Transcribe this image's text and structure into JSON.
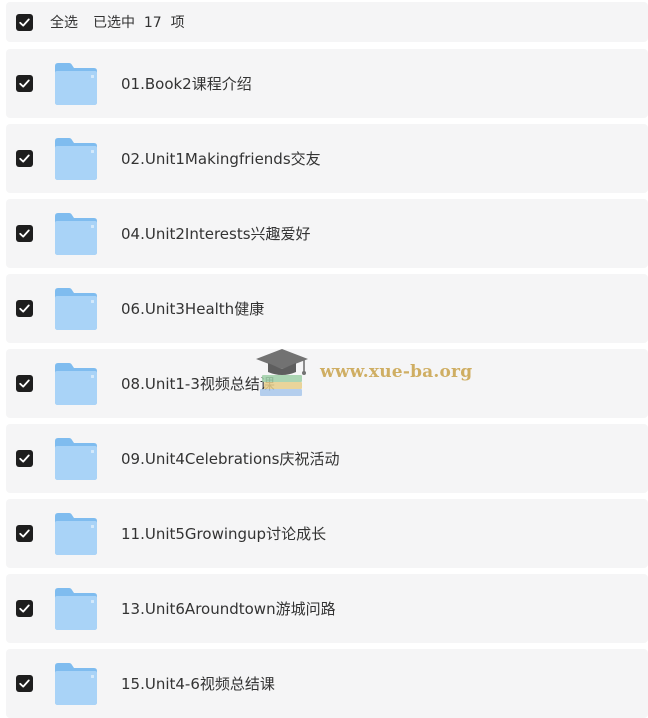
{
  "header": {
    "select_all_label": "全选",
    "selected_text": "已选中  17  项"
  },
  "items": [
    {
      "label": "01.Book2课程介绍",
      "checked": true
    },
    {
      "label": "02.Unit1Makingfriends交友",
      "checked": true
    },
    {
      "label": "04.Unit2Interests兴趣爱好",
      "checked": true
    },
    {
      "label": "06.Unit3Health健康",
      "checked": true
    },
    {
      "label": "08.Unit1-3视频总结课",
      "checked": true
    },
    {
      "label": "09.Unit4Celebrations庆祝活动",
      "checked": true
    },
    {
      "label": "11.Unit5Growingup讨论成长",
      "checked": true
    },
    {
      "label": "13.Unit6Aroundtown游城问路",
      "checked": true
    },
    {
      "label": "15.Unit4-6视频总结课",
      "checked": true
    }
  ],
  "watermark": {
    "text": "www.xue-ba.org"
  },
  "colors": {
    "row_bg": "#f5f5f6",
    "checkbox": "#1e1e1e",
    "folder_light": "#a9d3f7",
    "folder_dark": "#7fbcef",
    "watermark": "#c9a24a"
  }
}
